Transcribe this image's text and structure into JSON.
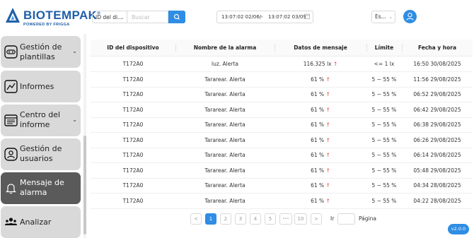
{
  "header": {
    "logo_text": "BIOTEMPAK",
    "logo_registered": "®",
    "logo_sub": "POWERED BY FRIGGA",
    "device_select": "ID del di...",
    "search_placeholder": "Buscar",
    "date_start": "13:07:02 02/06/",
    "date_arrow": "→",
    "date_end": "13:07:02 03/09/",
    "language": "Es..."
  },
  "sidebar": {
    "items": [
      {
        "label": "Gestión de plantillas",
        "icon": "template-icon",
        "has_submenu": true,
        "active": false
      },
      {
        "label": "Informes",
        "icon": "chart-line-icon",
        "has_submenu": false,
        "active": false
      },
      {
        "label": "Centro del informe",
        "icon": "report-center-icon",
        "has_submenu": true,
        "active": false
      },
      {
        "label": "Gestión de usuarios",
        "icon": "user-icon",
        "has_submenu": false,
        "active": false
      },
      {
        "label": "Mensaje de alarma",
        "icon": "bell-icon",
        "has_submenu": false,
        "active": true
      },
      {
        "label": "Analizar",
        "icon": "users-icon",
        "has_submenu": false,
        "active": false
      }
    ]
  },
  "table": {
    "headers": [
      "ID del dispositivo",
      "Nombre de la alarma",
      "Datos de mensaje",
      "Límite",
      "Fecha y hora"
    ],
    "rows": [
      [
        "T172A0",
        "luz. Alerta",
        "116.325 lx",
        "<= 1 lx",
        "16:50 30/08/2025"
      ],
      [
        "T172A0",
        "Tararear. Alerta",
        "61 %",
        "5 ~ 55 %",
        "11:56 29/08/2025"
      ],
      [
        "T172A0",
        "Tararear. Alerta",
        "61 %",
        "5 ~ 55 %",
        "06:52 29/08/2025"
      ],
      [
        "T172A0",
        "Tararear. Alerta",
        "61 %",
        "5 ~ 55 %",
        "06:42 29/08/2025"
      ],
      [
        "T172A0",
        "Tararear. Alerta",
        "61 %",
        "5 ~ 55 %",
        "06:38 29/08/2025"
      ],
      [
        "T172A0",
        "Tararear. Alerta",
        "61 %",
        "5 ~ 55 %",
        "06:26 29/08/2025"
      ],
      [
        "T172A0",
        "Tararear. Alerta",
        "61 %",
        "5 ~ 55 %",
        "06:14 29/08/2025"
      ],
      [
        "T172A0",
        "Tararear. Alerta",
        "61 %",
        "5 ~ 55 %",
        "05:48 29/08/2025"
      ],
      [
        "T172A0",
        "Tararear. Alerta",
        "61 %",
        "5 ~ 55 %",
        "04:34 28/08/2025"
      ],
      [
        "T172A0",
        "Tararear. Alerta",
        "61 %",
        "5 ~ 55 %",
        "04:22 28/08/2025"
      ]
    ],
    "trend_symbol": "↑"
  },
  "pagination": {
    "prev": "<",
    "pages": [
      "1",
      "2",
      "3",
      "4",
      "5"
    ],
    "ellipsis": "•••",
    "last_page": "10",
    "next": ">",
    "goto_label": "Ir",
    "page_label": "Página",
    "current": 1
  },
  "version": "v2.0.0",
  "colors": {
    "accent": "#2f8de4",
    "brand": "#1f5fa8",
    "alert_up": "#e53935",
    "nav_bg": "#d9d9d9",
    "nav_active": "#5a5a5a"
  }
}
